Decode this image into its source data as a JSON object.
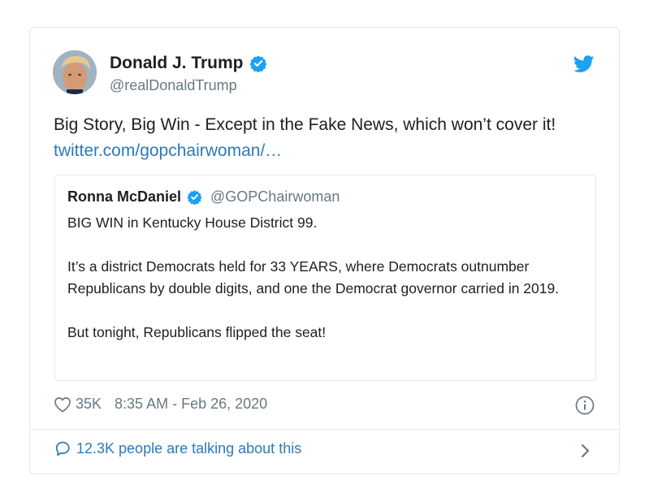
{
  "tweet": {
    "author": {
      "name": "Donald J. Trump",
      "handle": "@realDonaldTrump",
      "avatar_icon": "profile-photo"
    },
    "text": "Big Story, Big Win - Except in the Fake News, which won’t cover it!",
    "link": "twitter.com/gopchairwoman/…",
    "likes": "35K",
    "timestamp": "8:35 AM - Feb 26, 2020"
  },
  "quoted_tweet": {
    "author": {
      "name": "Ronna McDaniel",
      "handle": "@GOPChairwoman"
    },
    "paragraphs": [
      "BIG WIN in Kentucky House District 99.",
      "It’s a district Democrats held for 33 YEARS, where Democrats outnumber Republicans by double digits, and one the Democrat governor carried in 2019.",
      "But tonight, Republicans flipped the seat!"
    ]
  },
  "footer": {
    "talking_text": "12.3K people are talking about this"
  },
  "colors": {
    "accent": "#1da1f2",
    "link": "#2b7bb9",
    "muted": "#697882",
    "border": "#e1e8ed"
  }
}
